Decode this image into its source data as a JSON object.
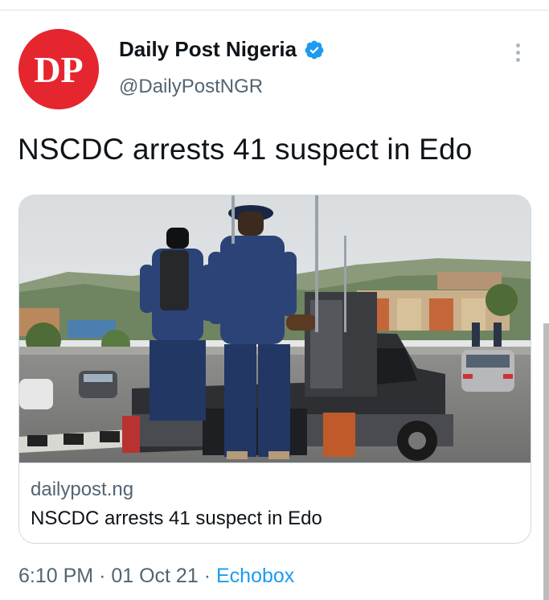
{
  "tweet": {
    "author": {
      "display_name": "Daily Post Nigeria",
      "handle": "@DailyPostNGR",
      "avatar_text": "DP",
      "verified": true,
      "brand_color": "#e5262e"
    },
    "text": "NSCDC arrests 41 suspect in Edo",
    "card": {
      "domain": "dailypost.ng",
      "title": "NSCDC arrests 41 suspect in Edo"
    },
    "meta": {
      "time": "6:10 PM",
      "separator": "·",
      "date": "01 Oct 21",
      "source": "Echobox"
    }
  },
  "icons": {
    "verified": "verified-badge-icon",
    "more": "more-vertical-icon"
  },
  "colors": {
    "accent": "#1d9bf0",
    "secondary_text": "#536471",
    "primary_text": "#0f1419",
    "border": "#cfd9de"
  }
}
